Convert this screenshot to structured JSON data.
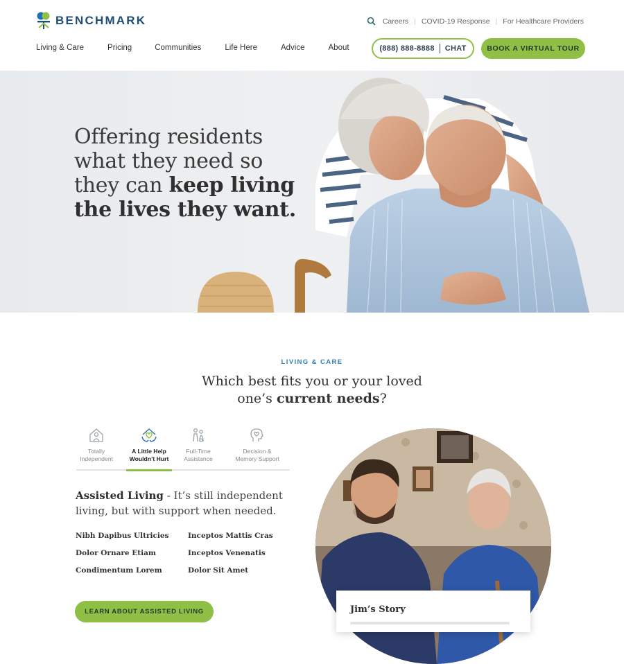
{
  "brand": {
    "name": "BENCHMARK",
    "colors": {
      "green": "#8fc045",
      "blue": "#2f7fb4",
      "navy": "#1f4e79"
    }
  },
  "top_links": [
    "Careers",
    "COVID-19 Response",
    "For Healthcare Providers"
  ],
  "nav": [
    "Living & Care",
    "Pricing",
    "Communities",
    "Life Here",
    "Advice",
    "About"
  ],
  "header": {
    "phone": "(888) 888-8888",
    "chat": "CHAT",
    "tour": "BOOK A VIRTUAL TOUR"
  },
  "hero": {
    "line1": "Offering residents",
    "line2": "what they need so",
    "line3_plain": "they can ",
    "line3_bold": "keep living",
    "line4_bold": "the lives they want."
  },
  "living": {
    "eyebrow": "LIVING & CARE",
    "title_line1": "Which best fits you or your loved",
    "title_line2_plain": "one’s ",
    "title_line2_bold": "current needs",
    "title_line2_end": "?",
    "tabs": [
      {
        "line1": "Totally",
        "line2": "Independent",
        "icon": "house-person-icon"
      },
      {
        "line1": "A Little Help",
        "line2": "Wouldn’t Hurt",
        "icon": "helping-hands-heart-icon"
      },
      {
        "line1": "Full-Time",
        "line2": "Assistance",
        "icon": "assisted-people-icon"
      },
      {
        "line1": "Decision &",
        "line2": "Memory Support",
        "icon": "head-heart-icon"
      }
    ],
    "desc_bold": "Assisted Living",
    "desc_rest": " - It’s still independent living, but with support when needed.",
    "features": [
      "Nibh Dapibus Ultricies",
      "Inceptos Mattis Cras",
      "Dolor Ornare Etiam",
      "Inceptos Venenatis",
      "Condimentum Lorem",
      "Dolor Sit Amet"
    ],
    "cta": "LEARN ABOUT ASSISTED LIVING",
    "story_title": "Jim’s Story"
  }
}
